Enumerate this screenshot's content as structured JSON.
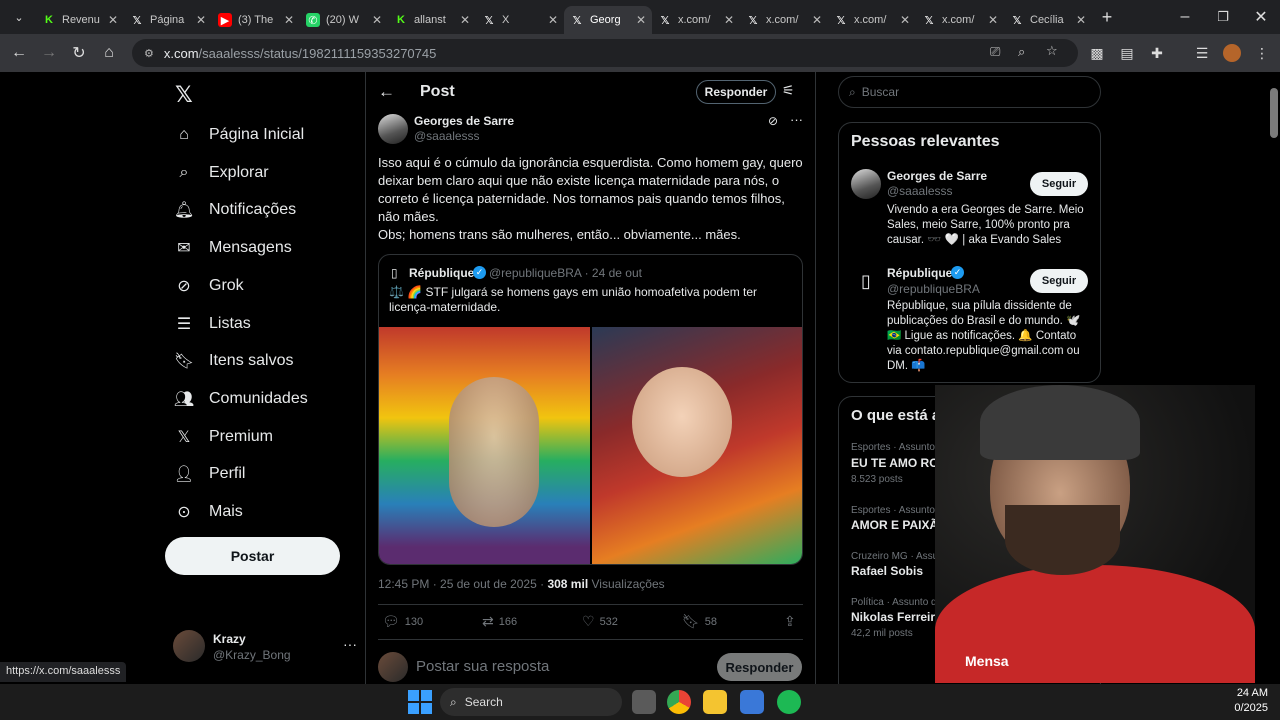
{
  "browser": {
    "tabs": [
      {
        "label": "Revenu",
        "icon": "k"
      },
      {
        "label": "Página",
        "icon": "x"
      },
      {
        "label": "(3) The",
        "icon": "yt"
      },
      {
        "label": "(20) W",
        "icon": "wa"
      },
      {
        "label": "allanst",
        "icon": "k"
      },
      {
        "label": "X",
        "icon": "x"
      },
      {
        "label": "Georg",
        "icon": "x"
      },
      {
        "label": "x.com/",
        "icon": "x"
      },
      {
        "label": "x.com/",
        "icon": "x"
      },
      {
        "label": "x.com/",
        "icon": "x"
      },
      {
        "label": "x.com/",
        "icon": "x"
      },
      {
        "label": "Cecília",
        "icon": "x"
      }
    ],
    "url_host": "x.com",
    "url_path": "/saaalesss/status/1982111159353270745",
    "status_url": "https://x.com/saaalesss"
  },
  "nav": {
    "items": [
      "Página Inicial",
      "Explorar",
      "Notificações",
      "Mensagens",
      "Grok",
      "Listas",
      "Itens salvos",
      "Comunidades",
      "Premium",
      "Perfil",
      "Mais"
    ],
    "post_button": "Postar",
    "account_name": "Krazy",
    "account_handle": "@Krazy_Bong"
  },
  "main": {
    "header_title": "Post",
    "reply_button": "Responder",
    "author_name": "Georges de Sarre",
    "author_handle": "@saaalesss",
    "text": "Isso aqui é o cúmulo da ignorância esquerdista. Como homem gay, quero deixar bem claro aqui que não existe licença maternidade para nós, o correto é licença paternidade. Nos tornamos pais quando temos filhos, não mães.\nObs; homens trans são mulheres, então... obviamente... mães.",
    "quote": {
      "name": "République",
      "meta": "@republiqueBRA · 24 de out",
      "text": "⚖️ 🌈 STF julgará se homens gays em união homoafetiva podem ter licença-maternidade."
    },
    "date": "12:45 PM · 25 de out de 2025 · ",
    "views_count": "308 mil",
    "views_label": " Visualizações",
    "stats": {
      "replies": "130",
      "reposts": "166",
      "likes": "532",
      "bookmarks": "58"
    },
    "reply_placeholder": "Postar sua resposta",
    "reply_submit": "Responder"
  },
  "right": {
    "search_placeholder": "Buscar",
    "relevant_title": "Pessoas relevantes",
    "people": [
      {
        "name": "Georges de Sarre",
        "handle": "@saaalesss",
        "bio": "Vivendo a era Georges de Sarre. Meio Sales, meio Sarre, 100% pronto pra causar. 🕶️ 🤍 | aka Evando Sales",
        "follow": "Seguir"
      },
      {
        "name": "République",
        "handle": "@republiqueBRA",
        "bio": "République, sua pílula dissidente de publicações do Brasil e do mundo. 🕊️ 🇧🇷 Ligue as notificações. 🔔 Contato via contato.republique@gmail.com ou DM. 📫",
        "follow": "Seguir"
      }
    ],
    "trends_title": "O que está aconte",
    "trends": [
      {
        "category": "Esportes · Assunto do Momento",
        "name": "EU TE AMO ROSSI",
        "posts": "8.523 posts"
      },
      {
        "category": "Esportes · Assunto do Momento",
        "name": "AMOR E PAIXÃO",
        "posts": ""
      },
      {
        "category": "Cruzeiro MG · Assunto do Momento",
        "name": "Rafael Sobis",
        "posts": ""
      },
      {
        "category": "Política · Assunto do Momento",
        "name": "Nikolas Ferreira",
        "posts": "42,2 mil posts"
      }
    ]
  },
  "webcam": {
    "overlay_text": "Mensa"
  },
  "taskbar": {
    "search": "Search",
    "time": "24 AM",
    "date": "0/2025"
  }
}
